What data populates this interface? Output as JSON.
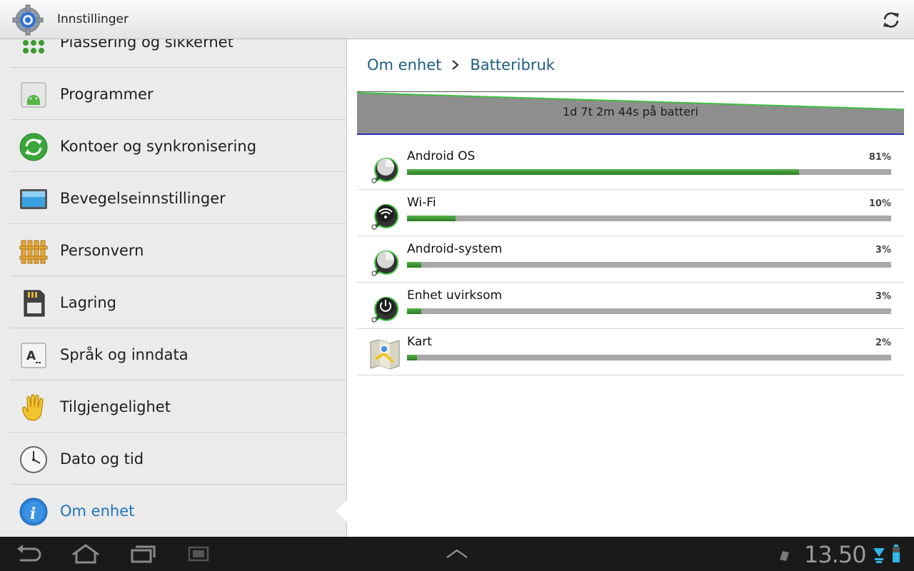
{
  "titlebar": {
    "title": "Innstillinger",
    "sync_icon": "sync-icon",
    "app_icon": "settings-gear-icon"
  },
  "sidebar": {
    "items": [
      {
        "label": "Plassering og sikkerhet",
        "icon": "location-security-icon"
      },
      {
        "label": "Programmer",
        "icon": "android-apps-icon"
      },
      {
        "label": "Kontoer og synkronisering",
        "icon": "sync-accounts-icon"
      },
      {
        "label": "Bevegelseinnstillinger",
        "icon": "motion-tablet-icon"
      },
      {
        "label": "Personvern",
        "icon": "fence-privacy-icon"
      },
      {
        "label": "Lagring",
        "icon": "sd-card-storage-icon"
      },
      {
        "label": "Språk og inndata",
        "icon": "keyboard-language-icon"
      },
      {
        "label": "Tilgjengelighet",
        "icon": "hand-accessibility-icon"
      },
      {
        "label": "Dato og tid",
        "icon": "clock-icon"
      },
      {
        "label": "Om enhet",
        "icon": "info-icon",
        "selected": true
      }
    ]
  },
  "breadcrumb": {
    "parent": "Om enhet",
    "current": "Batteribruk"
  },
  "battery_graph": {
    "label": "1d 7t 2m 44s på batteri",
    "start_level": 1.0,
    "end_level": 0.58
  },
  "usage": [
    {
      "name": "Android OS",
      "percent_label": "81%",
      "percent": 81,
      "icon": "android-os-icon"
    },
    {
      "name": "Wi-Fi",
      "percent_label": "10%",
      "percent": 10,
      "icon": "wifi-icon"
    },
    {
      "name": "Android-system",
      "percent_label": "3%",
      "percent": 3,
      "icon": "android-system-icon"
    },
    {
      "name": "Enhet uvirksom",
      "percent_label": "3%",
      "percent": 3,
      "icon": "power-icon"
    },
    {
      "name": "Kart",
      "percent_label": "2%",
      "percent": 2,
      "icon": "maps-icon"
    }
  ],
  "statusbar": {
    "time": "13.50"
  },
  "colors": {
    "accent": "#1f75b8",
    "breadcrumb": "#1e5c86",
    "bar_fill": "#3b9a31",
    "bar_track": "#a8a8a8"
  }
}
